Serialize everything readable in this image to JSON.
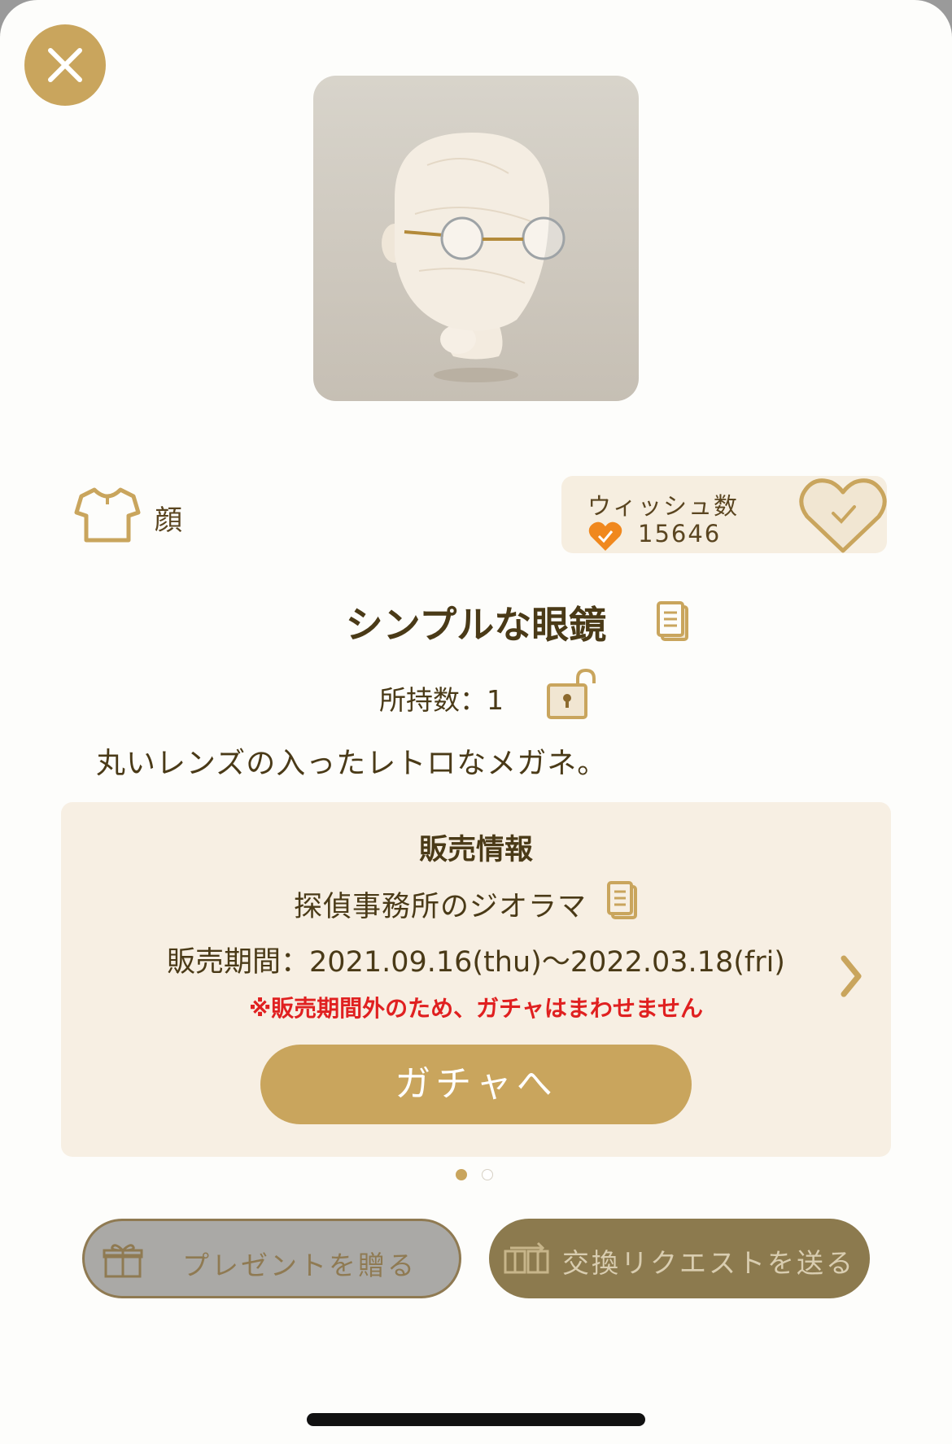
{
  "item": {
    "category": "顔",
    "name": "シンプルな眼鏡",
    "owned_label": "所持数：1",
    "description": "丸いレンズの入ったレトロなメガネ。"
  },
  "wish": {
    "label": "ウィッシュ数",
    "count": "15646"
  },
  "sales": {
    "title": "販売情報",
    "gacha_name": "探偵事務所のジオラマ",
    "period": "販売期間：2021.09.16(thu)〜2022.03.18(fri)",
    "warning": "※販売期間外のため、ガチャはまわせません",
    "button_label": "ガチャへ"
  },
  "pagination": {
    "current": 1,
    "total": 2
  },
  "actions": {
    "present_label": "プレゼントを贈る",
    "trade_label": "交換リクエストを送る"
  },
  "icons": {
    "close": "close-icon",
    "category": "shirt-icon",
    "wish": "heart-check-icon",
    "copy": "copy-icon",
    "lock": "unlock-icon",
    "next": "chevron-right-icon",
    "gift": "gift-icon",
    "trade": "trade-icon"
  },
  "colors": {
    "accent": "#c9a55d",
    "text": "#4a3a17",
    "panel": "#f7efe3",
    "warning": "#e02020",
    "wish_heart": "#f0881e"
  }
}
